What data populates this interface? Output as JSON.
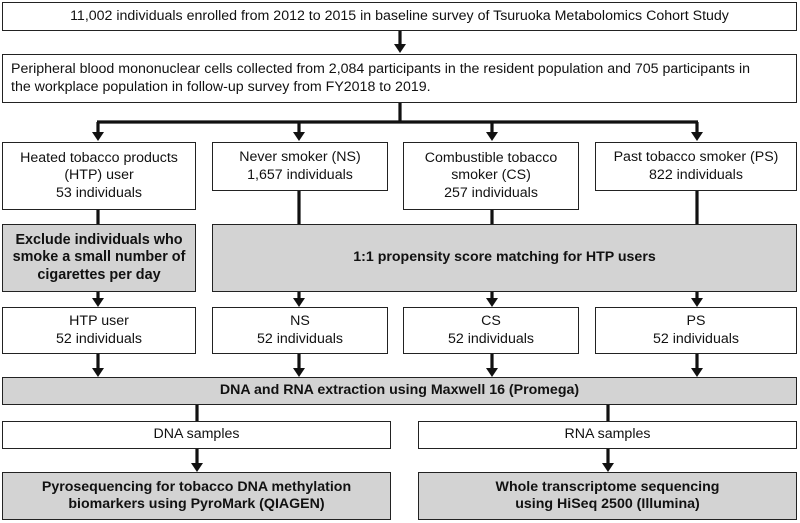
{
  "diagram": {
    "enrollment": "11,002 individuals enrolled from 2012 to 2015 in baseline survey of Tsuruoka Metabolomics Cohort Study",
    "pbmc_collection": "Peripheral blood mononuclear cells collected from 2,084 participants in the resident population and 705 participants in\nthe workplace population in follow-up survey from FY2018 to 2019.",
    "groups": [
      {
        "label": "Heated tobacco products\n(HTP) user\n53 individuals"
      },
      {
        "label": "Never smoker (NS)\n1,657 individuals"
      },
      {
        "label": "Combustible tobacco\nsmoker (CS)\n257 individuals"
      },
      {
        "label": "Past tobacco smoker (PS)\n822 individuals"
      }
    ],
    "exclusion": "Exclude individuals who\nsmoke a small number of\ncigarettes per day",
    "matching": "1:1 propensity score matching for HTP users",
    "matched_groups": [
      {
        "label": "HTP user\n52 individuals"
      },
      {
        "label": "NS\n52 individuals"
      },
      {
        "label": "CS\n52 individuals"
      },
      {
        "label": "PS\n52 individuals"
      }
    ],
    "extraction": "DNA and RNA extraction using Maxwell 16 (Promega)",
    "samples": [
      {
        "label": "DNA samples"
      },
      {
        "label": "RNA samples"
      }
    ],
    "analyses": [
      {
        "label": "Pyrosequencing for tobacco DNA methylation\nbiomarkers using PyroMark (QIAGEN)"
      },
      {
        "label": "Whole transcriptome sequencing\nusing HiSeq 2500 (Illumina)"
      }
    ],
    "colors": {
      "process_box_fill": "#d3d3d3",
      "plain_box_fill": "#ffffff",
      "line": "#111111"
    }
  }
}
